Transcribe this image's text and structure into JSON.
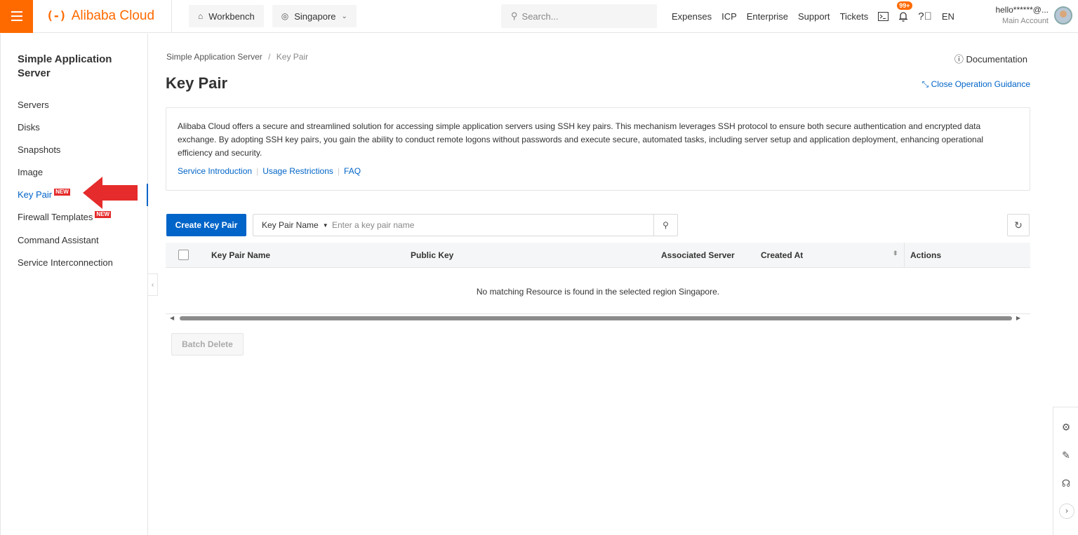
{
  "topbar": {
    "brand": "Alibaba Cloud",
    "brand_mark": "(-)",
    "workbench": "Workbench",
    "region": "Singapore",
    "search_placeholder": "Search...",
    "links": [
      "Expenses",
      "ICP",
      "Enterprise",
      "Support",
      "Tickets"
    ],
    "notifications_badge": "99+",
    "language": "EN",
    "account_name": "hello******@...",
    "account_type": "Main Account"
  },
  "sidebar": {
    "title": "Simple Application Server",
    "items": [
      {
        "label": "Servers"
      },
      {
        "label": "Disks"
      },
      {
        "label": "Snapshots"
      },
      {
        "label": "Image"
      },
      {
        "label": "Key Pair",
        "tag": "NEW"
      },
      {
        "label": "Firewall Templates",
        "tag": "NEW"
      },
      {
        "label": "Command Assistant"
      },
      {
        "label": "Service Interconnection"
      }
    ],
    "active_index": 4
  },
  "breadcrumb": {
    "root": "Simple Application Server",
    "separator": "/",
    "current": "Key Pair"
  },
  "documentation": "Documentation",
  "page_title": "Key Pair",
  "close_guidance": "Close Operation Guidance",
  "info": {
    "text": "Alibaba Cloud offers a secure and streamlined solution for accessing simple application servers using SSH key pairs. This mechanism leverages SSH protocol to ensure both secure authentication and encrypted data exchange. By adopting SSH key pairs, you gain the ability to conduct remote logons without passwords and execute secure, automated tasks, including server setup and application deployment, enhancing operational efficiency and security.",
    "links": [
      "Service Introduction",
      "Usage Restrictions",
      "FAQ"
    ]
  },
  "toolbar": {
    "create_label": "Create Key Pair",
    "filter_field": "Key Pair Name",
    "filter_placeholder": "Enter a key pair name",
    "filter_value": ""
  },
  "table": {
    "columns": [
      "Key Pair Name",
      "Public Key",
      "Associated Server",
      "Created At",
      "Actions"
    ],
    "rows": [],
    "empty_message": "No matching Resource is found in the selected region Singapore."
  },
  "batch_delete_label": "Batch Delete",
  "colors": {
    "accent": "#ff6a00",
    "primary": "#0064c8",
    "annotation_arrow": "#e52b2b"
  }
}
